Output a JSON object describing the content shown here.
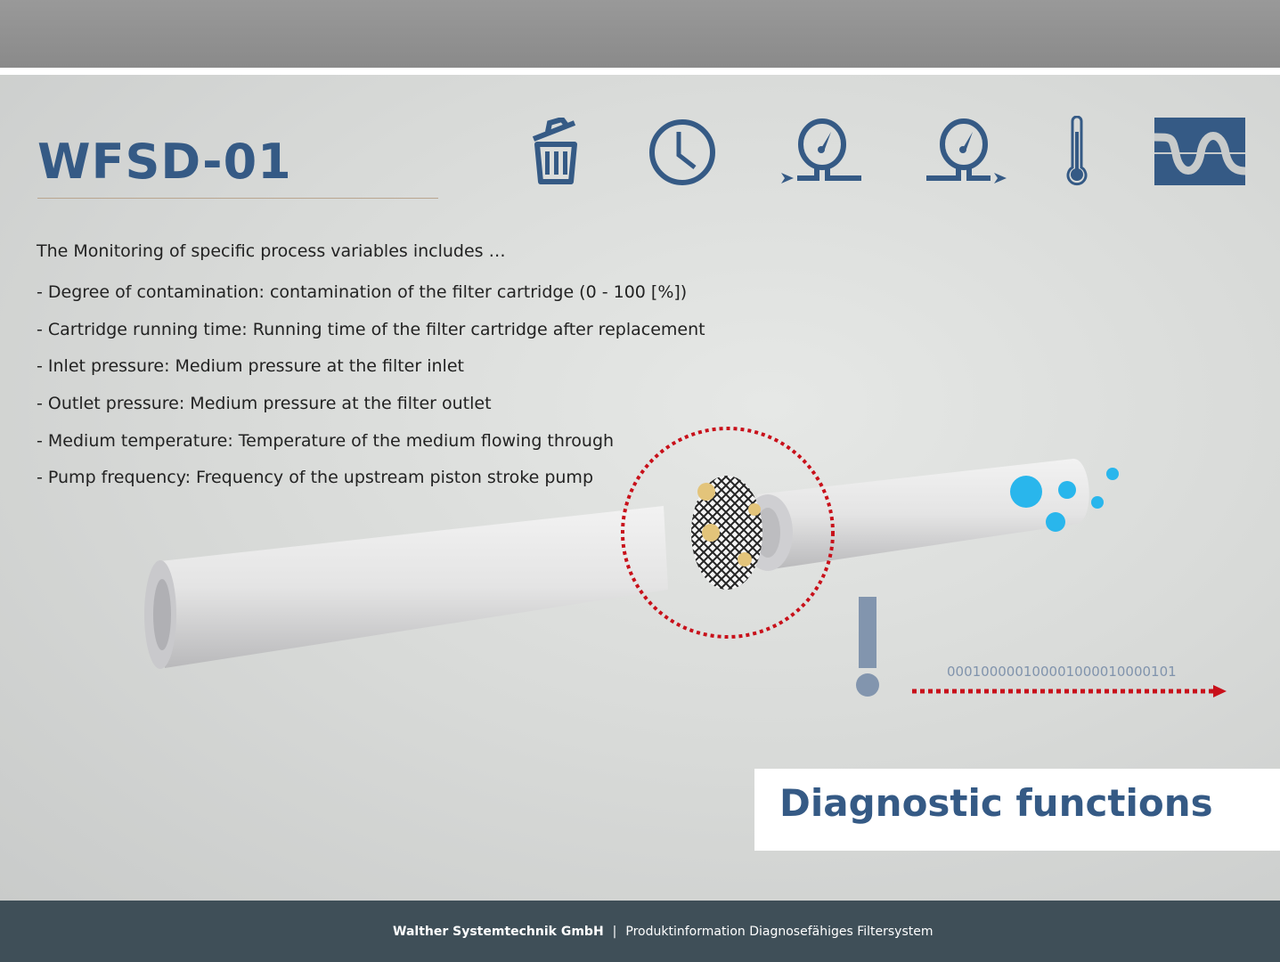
{
  "title": "WFSD-01",
  "intro": "The Monitoring of specific process variables includes …",
  "items": [
    "- Degree of contamination: contamination of the filter cartridge (0 - 100 [%])",
    "- Cartridge running time: Running time of the filter cartridge after replacement",
    "- Inlet pressure: Medium pressure at the filter inlet",
    "- Outlet pressure: Medium pressure at the filter outlet",
    "- Medium temperature: Temperature of the medium flowing through",
    "- Pump frequency: Frequency of the upstream piston stroke pump"
  ],
  "icons": [
    "trash-icon",
    "clock-icon",
    "inlet-pressure-gauge-icon",
    "outlet-pressure-gauge-icon",
    "thermometer-icon",
    "pump-wave-icon"
  ],
  "binary": "000100000100001000010000101",
  "section_label": "Diagnostic functions",
  "footer": {
    "company": "Walther Systemtechnik GmbH",
    "separator": "|",
    "product": "Produktinformation Diagnosefähiges Filtersystem"
  },
  "colors": {
    "brand": "#355a85",
    "alert": "#c8101a",
    "footer": "#3f4f58"
  }
}
